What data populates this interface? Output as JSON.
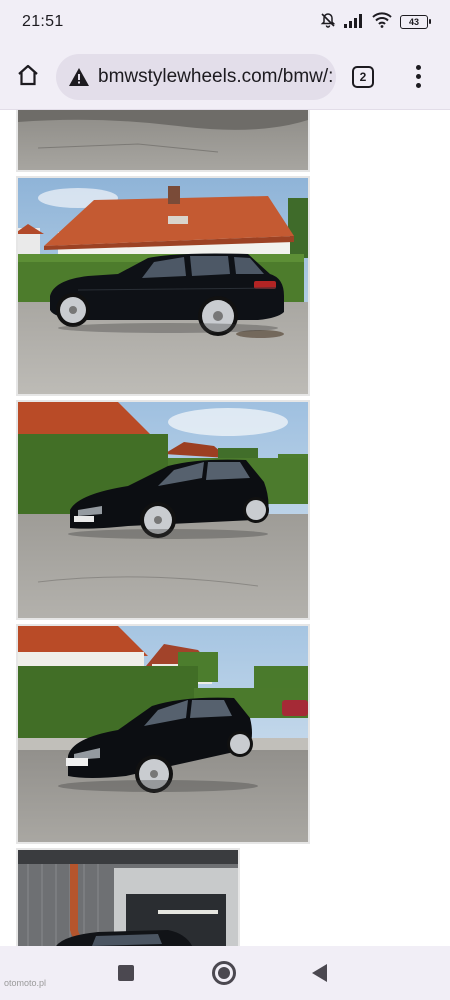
{
  "status_bar": {
    "time": "21:51",
    "battery": "43",
    "icons": [
      "mute-bell-icon",
      "signal-icon",
      "wifi-icon",
      "battery-icon"
    ]
  },
  "browser": {
    "url": "bmwstylewheels.com/bmw/:",
    "tab_count": "2",
    "icons": [
      "home-icon",
      "not-secure-warning-icon",
      "tabs-icon",
      "more-vert-icon"
    ]
  },
  "gallery": {
    "photos": [
      {
        "subject": "asphalt-road-cropped"
      },
      {
        "subject": "black-bmw-touring-side-view"
      },
      {
        "subject": "black-bmw-touring-front-three-quarter"
      },
      {
        "subject": "black-bmw-touring-front-three-quarter-2"
      },
      {
        "subject": "bmw-in-garage"
      }
    ]
  },
  "watermark": "otomoto.pl",
  "nav_bar": {
    "icons": [
      "recents-square-icon",
      "home-circle-icon",
      "back-triangle-icon"
    ]
  }
}
